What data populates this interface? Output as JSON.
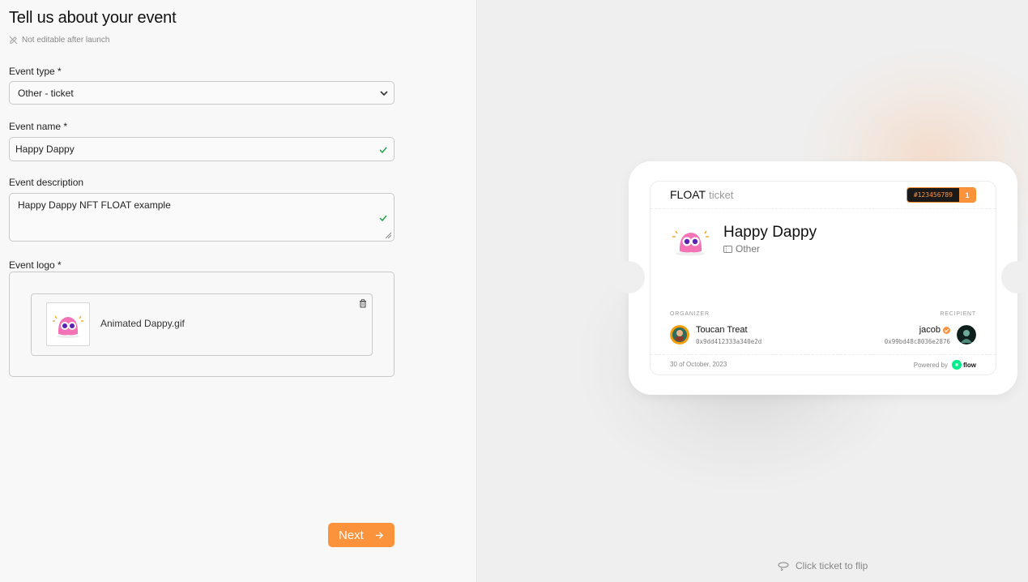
{
  "form": {
    "title": "Tell us about your event",
    "notice": "Not editable after launch",
    "event_type_label": "Event type *",
    "event_type_value": "Other - ticket",
    "event_name_label": "Event name  *",
    "event_name_value": "Happy Dappy",
    "event_desc_label": "Event description",
    "event_desc_value": "Happy Dappy NFT FLOAT example",
    "event_logo_label": "Event logo *",
    "logo_file_name": "Animated Dappy.gif",
    "next_label": "Next"
  },
  "ticket": {
    "brand": "FLOAT",
    "brand_suffix": "ticket",
    "serial": "#123456789",
    "count": "1",
    "event_name": "Happy Dappy",
    "event_type": "Other",
    "organizer_caption": "ORGANIZER",
    "organizer_name": "Toucan Treat",
    "organizer_address": "0x9dd412333a340e2d",
    "recipient_caption": "RECIPIENT",
    "recipient_name": "jacob",
    "recipient_address": "0x99bd48c8036e2876",
    "date": "30 of October, 2023",
    "powered_by": "Powered by",
    "flow_label": "flow"
  },
  "flip_hint": "Click ticket to flip",
  "colors": {
    "accent": "#fb923c",
    "valid": "#22a34a"
  }
}
